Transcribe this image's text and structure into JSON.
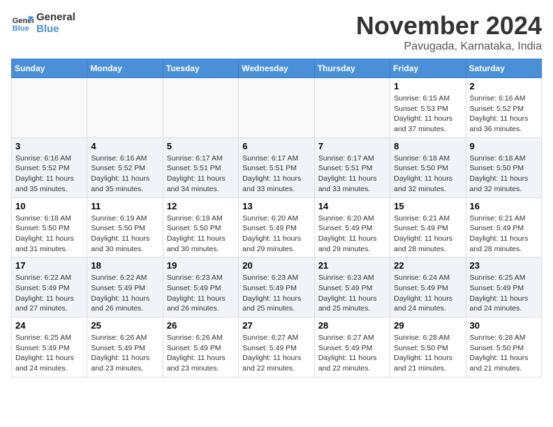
{
  "logo": {
    "line1": "General",
    "line2": "Blue"
  },
  "title": "November 2024",
  "location": "Pavugada, Karnataka, India",
  "days_of_week": [
    "Sunday",
    "Monday",
    "Tuesday",
    "Wednesday",
    "Thursday",
    "Friday",
    "Saturday"
  ],
  "weeks": [
    [
      {
        "day": "",
        "info": ""
      },
      {
        "day": "",
        "info": ""
      },
      {
        "day": "",
        "info": ""
      },
      {
        "day": "",
        "info": ""
      },
      {
        "day": "",
        "info": ""
      },
      {
        "day": "1",
        "info": "Sunrise: 6:15 AM\nSunset: 5:53 PM\nDaylight: 11 hours\nand 37 minutes."
      },
      {
        "day": "2",
        "info": "Sunrise: 6:16 AM\nSunset: 5:52 PM\nDaylight: 11 hours\nand 36 minutes."
      }
    ],
    [
      {
        "day": "3",
        "info": "Sunrise: 6:16 AM\nSunset: 5:52 PM\nDaylight: 11 hours\nand 35 minutes."
      },
      {
        "day": "4",
        "info": "Sunrise: 6:16 AM\nSunset: 5:52 PM\nDaylight: 11 hours\nand 35 minutes."
      },
      {
        "day": "5",
        "info": "Sunrise: 6:17 AM\nSunset: 5:51 PM\nDaylight: 11 hours\nand 34 minutes."
      },
      {
        "day": "6",
        "info": "Sunrise: 6:17 AM\nSunset: 5:51 PM\nDaylight: 11 hours\nand 33 minutes."
      },
      {
        "day": "7",
        "info": "Sunrise: 6:17 AM\nSunset: 5:51 PM\nDaylight: 11 hours\nand 33 minutes."
      },
      {
        "day": "8",
        "info": "Sunrise: 6:18 AM\nSunset: 5:50 PM\nDaylight: 11 hours\nand 32 minutes."
      },
      {
        "day": "9",
        "info": "Sunrise: 6:18 AM\nSunset: 5:50 PM\nDaylight: 11 hours\nand 32 minutes."
      }
    ],
    [
      {
        "day": "10",
        "info": "Sunrise: 6:18 AM\nSunset: 5:50 PM\nDaylight: 11 hours\nand 31 minutes."
      },
      {
        "day": "11",
        "info": "Sunrise: 6:19 AM\nSunset: 5:50 PM\nDaylight: 11 hours\nand 30 minutes."
      },
      {
        "day": "12",
        "info": "Sunrise: 6:19 AM\nSunset: 5:50 PM\nDaylight: 11 hours\nand 30 minutes."
      },
      {
        "day": "13",
        "info": "Sunrise: 6:20 AM\nSunset: 5:49 PM\nDaylight: 11 hours\nand 29 minutes."
      },
      {
        "day": "14",
        "info": "Sunrise: 6:20 AM\nSunset: 5:49 PM\nDaylight: 11 hours\nand 29 minutes."
      },
      {
        "day": "15",
        "info": "Sunrise: 6:21 AM\nSunset: 5:49 PM\nDaylight: 11 hours\nand 28 minutes."
      },
      {
        "day": "16",
        "info": "Sunrise: 6:21 AM\nSunset: 5:49 PM\nDaylight: 11 hours\nand 28 minutes."
      }
    ],
    [
      {
        "day": "17",
        "info": "Sunrise: 6:22 AM\nSunset: 5:49 PM\nDaylight: 11 hours\nand 27 minutes."
      },
      {
        "day": "18",
        "info": "Sunrise: 6:22 AM\nSunset: 5:49 PM\nDaylight: 11 hours\nand 26 minutes."
      },
      {
        "day": "19",
        "info": "Sunrise: 6:23 AM\nSunset: 5:49 PM\nDaylight: 11 hours\nand 26 minutes."
      },
      {
        "day": "20",
        "info": "Sunrise: 6:23 AM\nSunset: 5:49 PM\nDaylight: 11 hours\nand 25 minutes."
      },
      {
        "day": "21",
        "info": "Sunrise: 6:23 AM\nSunset: 5:49 PM\nDaylight: 11 hours\nand 25 minutes."
      },
      {
        "day": "22",
        "info": "Sunrise: 6:24 AM\nSunset: 5:49 PM\nDaylight: 11 hours\nand 24 minutes."
      },
      {
        "day": "23",
        "info": "Sunrise: 6:25 AM\nSunset: 5:49 PM\nDaylight: 11 hours\nand 24 minutes."
      }
    ],
    [
      {
        "day": "24",
        "info": "Sunrise: 6:25 AM\nSunset: 5:49 PM\nDaylight: 11 hours\nand 24 minutes."
      },
      {
        "day": "25",
        "info": "Sunrise: 6:26 AM\nSunset: 5:49 PM\nDaylight: 11 hours\nand 23 minutes."
      },
      {
        "day": "26",
        "info": "Sunrise: 6:26 AM\nSunset: 5:49 PM\nDaylight: 11 hours\nand 23 minutes."
      },
      {
        "day": "27",
        "info": "Sunrise: 6:27 AM\nSunset: 5:49 PM\nDaylight: 11 hours\nand 22 minutes."
      },
      {
        "day": "28",
        "info": "Sunrise: 6:27 AM\nSunset: 5:49 PM\nDaylight: 11 hours\nand 22 minutes."
      },
      {
        "day": "29",
        "info": "Sunrise: 6:28 AM\nSunset: 5:50 PM\nDaylight: 11 hours\nand 21 minutes."
      },
      {
        "day": "30",
        "info": "Sunrise: 6:28 AM\nSunset: 5:50 PM\nDaylight: 11 hours\nand 21 minutes."
      }
    ]
  ]
}
